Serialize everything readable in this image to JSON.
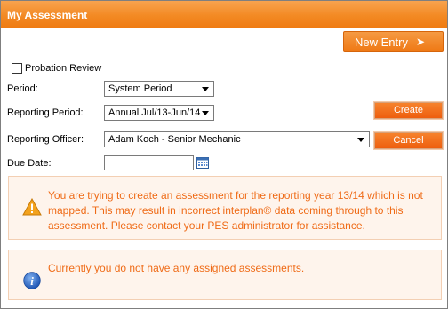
{
  "panel": {
    "title": "My Assessment",
    "new_entry_label": "New Entry"
  },
  "form": {
    "probation_label": "Probation Review",
    "probation_checked": false,
    "period_label": "Period:",
    "period_value": "System Period",
    "reporting_period_label": "Reporting Period:",
    "reporting_period_value": "Annual Jul/13-Jun/14",
    "reporting_officer_label": "Reporting Officer:",
    "reporting_officer_value": "Adam Koch - Senior Mechanic",
    "due_date_label": "Due Date:",
    "due_date_value": ""
  },
  "actions": {
    "create_label": "Create",
    "cancel_label": "Cancel"
  },
  "messages": {
    "warning_lines": [
      "You are trying to create an assessment for the reporting year 13/14 which is not",
      "mapped. This may result in incorrect interplan® data coming through to this",
      "assessment. Please contact your PES administrator for assistance."
    ],
    "info": "Currently you do not have any assigned assessments."
  },
  "colors": {
    "accent": "#f38a24",
    "message_text": "#ef6b17",
    "message_bg": "#fef4ec"
  },
  "icons": {
    "new_entry": "arrow-right-icon",
    "due_date": "calendar-icon",
    "warning": "warning-icon",
    "info": "info-icon"
  }
}
